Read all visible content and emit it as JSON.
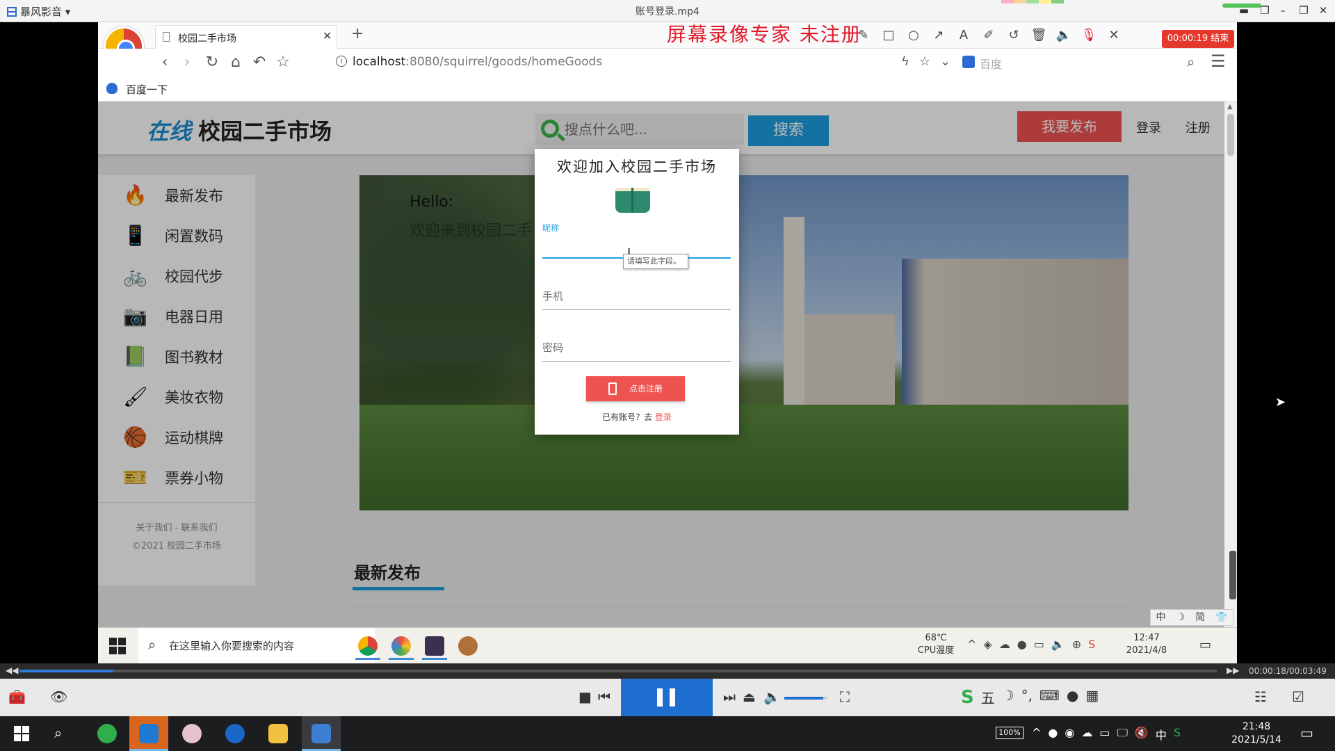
{
  "player": {
    "brand": "暴风影音",
    "filename": "账号登录.mp4",
    "current_time": "00:00:18",
    "duration": "00:03:49",
    "time_display": "00:00:18/00:03:49",
    "progress_fraction": 0.078,
    "volume_fraction": 0.9,
    "accent_color": "#1f6fd1"
  },
  "recorder": {
    "label": "屏幕录像专家  未注册",
    "timer": "00:00:19 结束",
    "tools": [
      "rect-icon",
      "circle-icon",
      "arrow-icon",
      "text-icon",
      "highlighter-icon",
      "undo-icon",
      "trash-icon",
      "speaker-icon",
      "mic-muted-icon",
      "close-icon"
    ]
  },
  "browser": {
    "tab_title": "校园二手市场",
    "url_host": "localhost",
    "url_rest": ":8080/squirrel/goods/homeGoods",
    "search_engine": "百度",
    "bookmark": "百度一下"
  },
  "site": {
    "logo_accent": "在线",
    "logo_text": "校园二手市场",
    "search_placeholder": "搜点什么吧...",
    "search_button": "搜索",
    "publish_button": "我要发布",
    "login": "登录",
    "register": "注册",
    "brand_color": "#1d9ee0",
    "accent_red": "#ef5350",
    "sidebar": [
      {
        "label": "最新发布",
        "icon": "fire-icon"
      },
      {
        "label": "闲置数码",
        "icon": "phone-icon"
      },
      {
        "label": "校园代步",
        "icon": "bicycle-icon"
      },
      {
        "label": "电器日用",
        "icon": "camera-icon"
      },
      {
        "label": "图书教材",
        "icon": "book-icon"
      },
      {
        "label": "美妆衣物",
        "icon": "brush-icon"
      },
      {
        "label": "运动棋牌",
        "icon": "basketball-icon"
      },
      {
        "label": "票券小物",
        "icon": "ticket-icon"
      }
    ],
    "about": "关于我们 - 联系我们",
    "copyright": "©2021 校园二手市场",
    "banner_hello": "Hello:",
    "banner_sub": "欢迎来到校园二手",
    "section_title": "最新发布"
  },
  "modal": {
    "title": "欢迎加入校园二手市场",
    "nickname_label": "昵称",
    "tooltip": "请填写此字段。",
    "phone_placeholder": "手机",
    "password_placeholder": "密码",
    "register_button": "点击注册",
    "footer_prefix": "已有账号？去",
    "footer_link": "登录"
  },
  "inner_taskbar": {
    "search_text": "在这里输入你要搜索的内容",
    "temp": "68℃",
    "temp_label": "CPU温度",
    "time": "12:47",
    "date": "2021/4/8",
    "ime": [
      "中",
      "☽",
      "简",
      "👕"
    ]
  },
  "taskbar": {
    "battery": "100%",
    "time": "21:48",
    "date": "2021/5/14",
    "ime": "中"
  }
}
